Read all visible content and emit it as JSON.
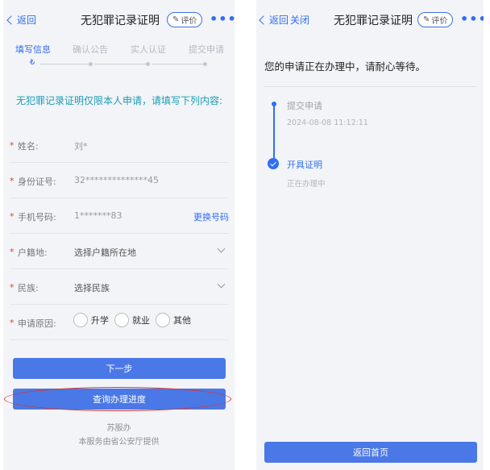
{
  "left": {
    "nav": {
      "back": "返回",
      "title": "无犯罪记录证明",
      "rate": "评价",
      "more": "•••"
    },
    "steps": [
      "填写信息",
      "确认公告",
      "实人认证",
      "提交申请"
    ],
    "current_step_mark": "₺",
    "notice": "无犯罪记录证明仅限本人申请，请填写下列内容:",
    "form": {
      "required_mark": "*",
      "name": {
        "label": "姓名:",
        "value": "刘*"
      },
      "id": {
        "label": "身份证号:",
        "value": "32**************45"
      },
      "phone": {
        "label": "手机号码:",
        "value": "1*******83",
        "action": "更换号码"
      },
      "hukou": {
        "label": "户籍地:",
        "placeholder": "选择户籍所在地"
      },
      "ethnicity": {
        "label": "民族:",
        "placeholder": "选择民族"
      },
      "reason": {
        "label": "申请原因:",
        "options": [
          "升学",
          "就业",
          "其他"
        ]
      }
    },
    "buttons": {
      "next": "下一步",
      "progress": "查询办理进度"
    },
    "footer": {
      "line1": "苏服办",
      "line2": "本服务由省公安厅提供"
    }
  },
  "right": {
    "nav": {
      "back": "返回",
      "close": "关闭",
      "title": "无犯罪记录证明",
      "rate": "评价",
      "more": "•••"
    },
    "status": "您的申请正在办理中，请耐心等待。",
    "timeline": [
      {
        "title": "提交申请",
        "sub": "2024-08-08 11:12:11"
      },
      {
        "title": "开具证明",
        "sub": "正在办理中"
      }
    ],
    "home_button": "返回首页"
  },
  "colors": {
    "accent": "#2f6ef2",
    "button": "#4a78e6",
    "notice": "#1d9bb5",
    "required": "#e0402f",
    "highlight_ring": "#d23b3b"
  }
}
